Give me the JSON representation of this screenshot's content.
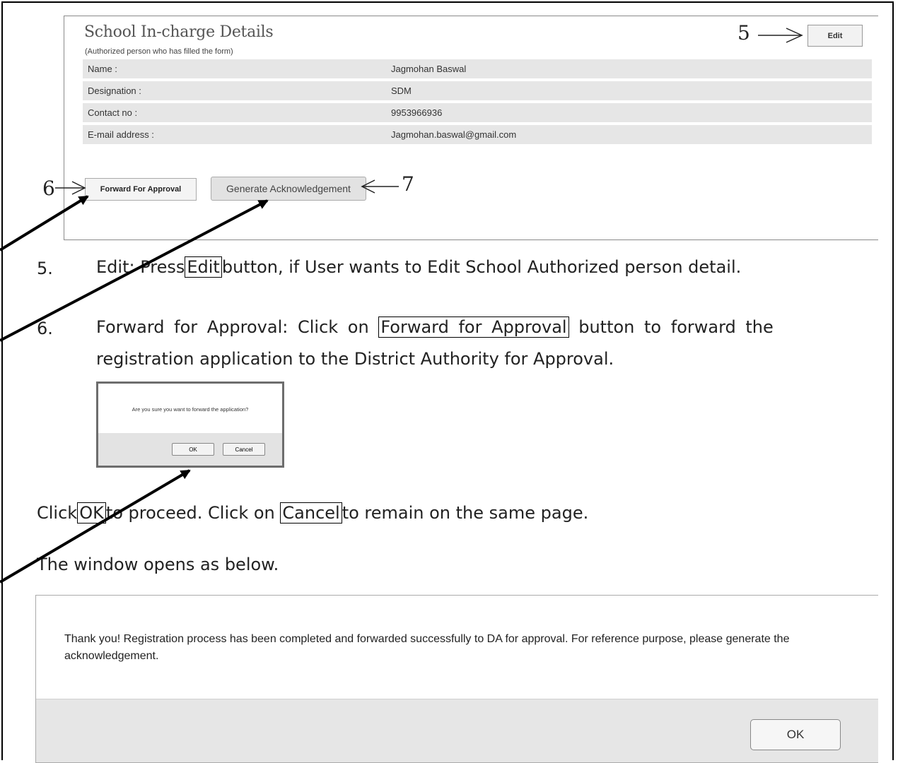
{
  "school_panel": {
    "title": "School In-charge Details",
    "subtitle": "(Authorized person who has filled the form)",
    "rows": [
      {
        "label": "Name :",
        "value": "Jagmohan Baswal"
      },
      {
        "label": "Designation :",
        "value": "SDM"
      },
      {
        "label": "Contact no :",
        "value": "9953966936"
      },
      {
        "label": "E-mail address :",
        "value": "Jagmohan.baswal@gmail.com"
      }
    ],
    "edit_label": "Edit",
    "forward_label": "Forward For Approval",
    "generate_label": "Generate Acknowledgement"
  },
  "annotations": {
    "n5": "5",
    "n6": "6",
    "n7": "7"
  },
  "steps": {
    "s5_num": "5.",
    "s5_a": "Edit: Press",
    "s5_box": "Edit",
    "s5_b": "button, if User wants to Edit School Authorized person detail.",
    "s6_num": "6.",
    "s6_a": "Forward for Approval: Click on",
    "s6_box": "Forward for Approval",
    "s6_b": "button to forward the",
    "s6_line2": "registration application to the District Authority for Approval."
  },
  "confirm_dialog": {
    "message": "Are you sure you want to forward the application?",
    "ok": "OK",
    "cancel": "Cancel"
  },
  "instruction": {
    "a": "Click",
    "ok_box": "OK",
    "b": "to proceed. Click on",
    "cancel_box": "Cancel",
    "c": "to remain on the same page."
  },
  "window_opens": "The window opens as below.",
  "thank_panel": {
    "message": "Thank you! Registration process has been completed and forwarded successfully to DA for approval. For reference purpose, please generate the acknowledgement.",
    "ok": "OK"
  }
}
